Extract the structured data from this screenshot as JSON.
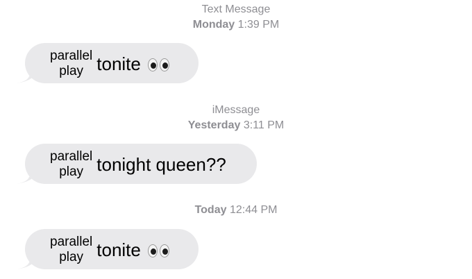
{
  "conversation": [
    {
      "stamp": {
        "service": "Text Message",
        "day": "Monday",
        "time": "1:39 PM"
      },
      "message": {
        "stacked_top": "parallel",
        "stacked_bottom": "play",
        "text": "tonite",
        "emoji": "eyes"
      }
    },
    {
      "stamp": {
        "service": "iMessage",
        "day": "Yesterday",
        "time": "3:11 PM"
      },
      "message": {
        "stacked_top": "parallel",
        "stacked_bottom": "play",
        "text": "tonight queen??",
        "emoji": ""
      }
    },
    {
      "stamp": {
        "service": "",
        "day": "Today",
        "time": "12:44 PM"
      },
      "message": {
        "stacked_top": "parallel",
        "stacked_bottom": "play",
        "text": "tonite",
        "emoji": "eyes"
      }
    }
  ],
  "colors": {
    "bubble_incoming": "#e9e9eb",
    "timestamp_text": "#8e8e93",
    "background": "#ffffff"
  }
}
